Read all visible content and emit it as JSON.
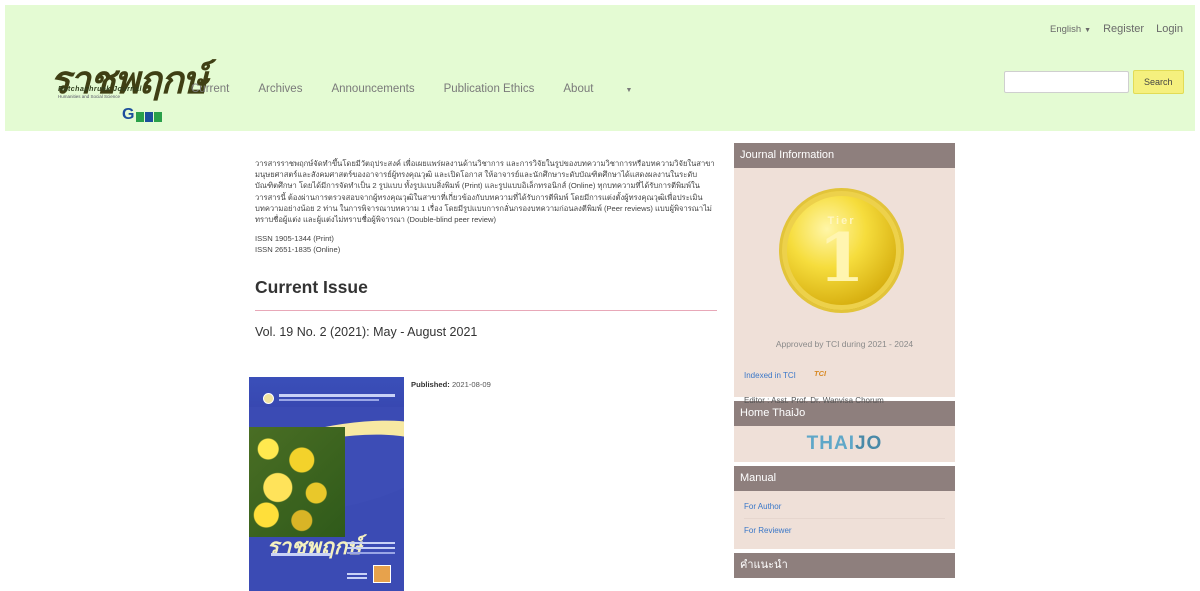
{
  "header": {
    "logo": {
      "wordmark": "ราชพฤกษ์",
      "subtitle": "Ratchaphruek Journal",
      "tagline": "Humanities and Social Science",
      "badge": "G"
    },
    "topnav": {
      "language": "English",
      "register": "Register",
      "login": "Login"
    },
    "nav": {
      "current": "Current",
      "archives": "Archives",
      "announcements": "Announcements",
      "ethics": "Publication Ethics",
      "about": "About"
    },
    "search": {
      "value": "",
      "button": "Search"
    }
  },
  "main": {
    "about": "วารสารราชพฤกษ์จัดทำขึ้นโดยมีวัตถุประสงค์ เพื่อเผยแพร่ผลงานด้านวิชาการ และการวิจัยในรูปของบทความวิชาการหรือบทความวิจัยในสาขามนุษยศาสตร์และสังคมศาสตร์ของอาจารย์ผู้ทรงคุณวุฒิ และเปิดโอกาส ให้อาจารย์และนักศึกษาระดับบัณฑิตศึกษาได้แสดงผลงานในระดับบัณฑิตศึกษา โดยได้มีการจัดทำเป็น 2 รูปแบบ ทั้งรูปแบบสิ่งพิมพ์ (Print) และรูปแบบอิเล็กทรอนิกส์ (Online) ทุกบทความที่ได้รับการตีพิมพ์ในวารสารนี้ ต้องผ่านการตรวจสอบจากผู้ทรงคุณวุฒิในสาขาที่เกี่ยวข้องกับบทความที่ได้รับการตีพิมพ์ โดยมีการแต่งตั้งผู้ทรงคุณวุฒิเพื่อประเมินบทความอย่างน้อย 2 ท่าน ในการพิจารณาบทความ 1 เรื่อง โดยมีรูปแบบการกลั่นกรองบทความก่อนลงตีพิมพ์ (Peer reviews) แบบผู้พิจารณาไม่ทราบชื่อผู้แต่ง และผู้แต่งไม่ทราบชื่อผู้พิจารณา (Double-blind peer review)",
    "issn_print": "ISSN 1905-1344 (Print)",
    "issn_online": "ISSN 2651-1835 (Online)",
    "current_issue_title": "Current Issue",
    "volume": "Vol. 19 No. 2 (2021): May - August 2021",
    "published_label": "Published:",
    "published_date": "2021-08-09"
  },
  "sidebar": {
    "journal_info": {
      "title": "Journal Information",
      "medal_tier": "Tier",
      "medal_number": "1",
      "approved": "Approved by TCI during 2021 - 2024",
      "indexed": "Indexed in TCI",
      "tci_logo": "TCI",
      "editor": "Editor : Asst. Prof. Dr. Wanvisa Chorum"
    },
    "home_thaijo": {
      "title": "Home ThaiJo",
      "logo_thai": "THAI",
      "logo_jo": "JO"
    },
    "manual": {
      "title": "Manual",
      "items": [
        "For Author",
        "For Reviewer"
      ]
    },
    "recommend": {
      "title": "คำแนะนำ"
    }
  }
}
